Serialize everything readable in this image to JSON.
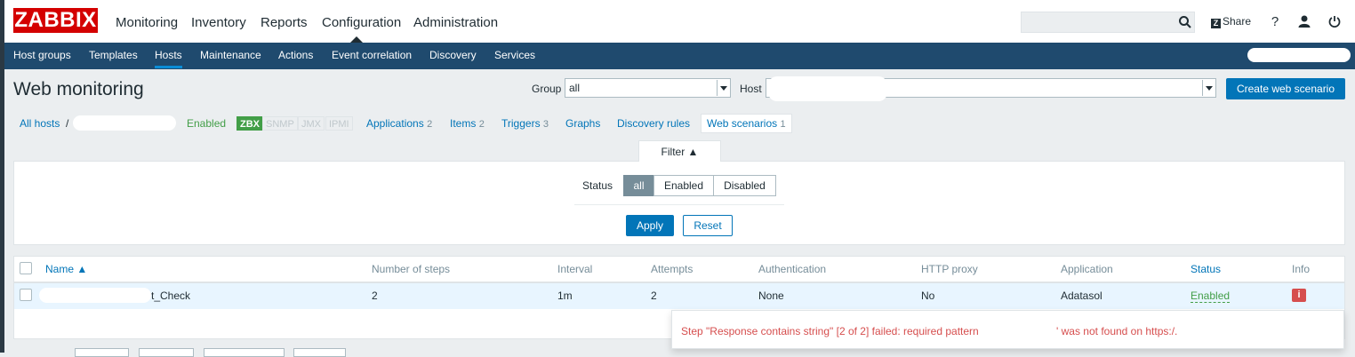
{
  "logo": "ZABBIX",
  "main_menu": [
    "Monitoring",
    "Inventory",
    "Reports",
    "Configuration",
    "Administration"
  ],
  "share_label": "Share",
  "share_logo": "Z",
  "help_label": "?",
  "sub_menu": [
    "Host groups",
    "Templates",
    "Hosts",
    "Maintenance",
    "Actions",
    "Event correlation",
    "Discovery",
    "Services"
  ],
  "page_title": "Web monitoring",
  "group_label": "Group",
  "group_value": "all",
  "host_label": "Host",
  "create_button": "Create web scenario",
  "breadcrumb": {
    "all_hosts": "All hosts",
    "separator": "/",
    "status": "Enabled",
    "badges": [
      "ZBX",
      "SNMP",
      "JMX",
      "IPMI"
    ],
    "applications": "Applications",
    "applications_count": "2",
    "items": "Items",
    "items_count": "2",
    "triggers": "Triggers",
    "triggers_count": "3",
    "graphs": "Graphs",
    "discovery_rules": "Discovery rules",
    "web_scenarios": "Web scenarios",
    "web_scenarios_count": "1"
  },
  "filter": {
    "tab_label": "Filter ▲",
    "status_label": "Status",
    "options": [
      "all",
      "Enabled",
      "Disabled"
    ],
    "selected": "all",
    "apply": "Apply",
    "reset": "Reset"
  },
  "table": {
    "columns": [
      "Name ▲",
      "Number of steps",
      "Interval",
      "Attempts",
      "Authentication",
      "HTTP proxy",
      "Application",
      "Status",
      "Info"
    ],
    "rows": [
      {
        "name": "t_Check",
        "steps": "2",
        "interval": "1m",
        "attempts": "2",
        "authentication": "None",
        "http_proxy": "No",
        "application": "Adatasol",
        "status": "Enabled",
        "info": "i"
      }
    ]
  },
  "tooltip": {
    "text": "Step \"Response contains string\" [2 of 2] failed: required pattern",
    "text_end": "' was not found on https:/."
  },
  "colors": {
    "brand": "#d40000",
    "accent": "#0275b8",
    "enabled": "#429e47",
    "error": "#d64e4e",
    "nav": "#1f4a6e"
  },
  "icons": [
    "search-icon",
    "help-icon",
    "user-icon",
    "power-icon",
    "info-icon",
    "sort-asc-icon"
  ]
}
